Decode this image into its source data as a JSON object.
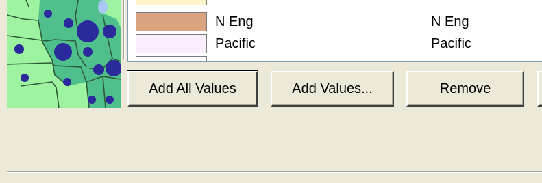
{
  "legend": {
    "rows": [
      {
        "symbol_label": "",
        "value_label": "",
        "color": "#fdf5c9"
      },
      {
        "symbol_label": "N Eng",
        "value_label": "N Eng",
        "color": "#d9a47f"
      },
      {
        "symbol_label": "Pacific",
        "value_label": "Pacific",
        "color": "#fbeefc"
      },
      {
        "symbol_label": "",
        "value_label": "",
        "color": "#ffffff"
      }
    ]
  },
  "buttons": {
    "add_all_values": "Add All Values",
    "add_values": "Add Values...",
    "remove": "Remove"
  },
  "colors": {
    "map_land": "#9ef3a0",
    "map_region": "#4fbf8b",
    "map_dot": "#2a2a9c",
    "map_water": "#a9c8f0",
    "dialog_face": "#ece9d8"
  }
}
